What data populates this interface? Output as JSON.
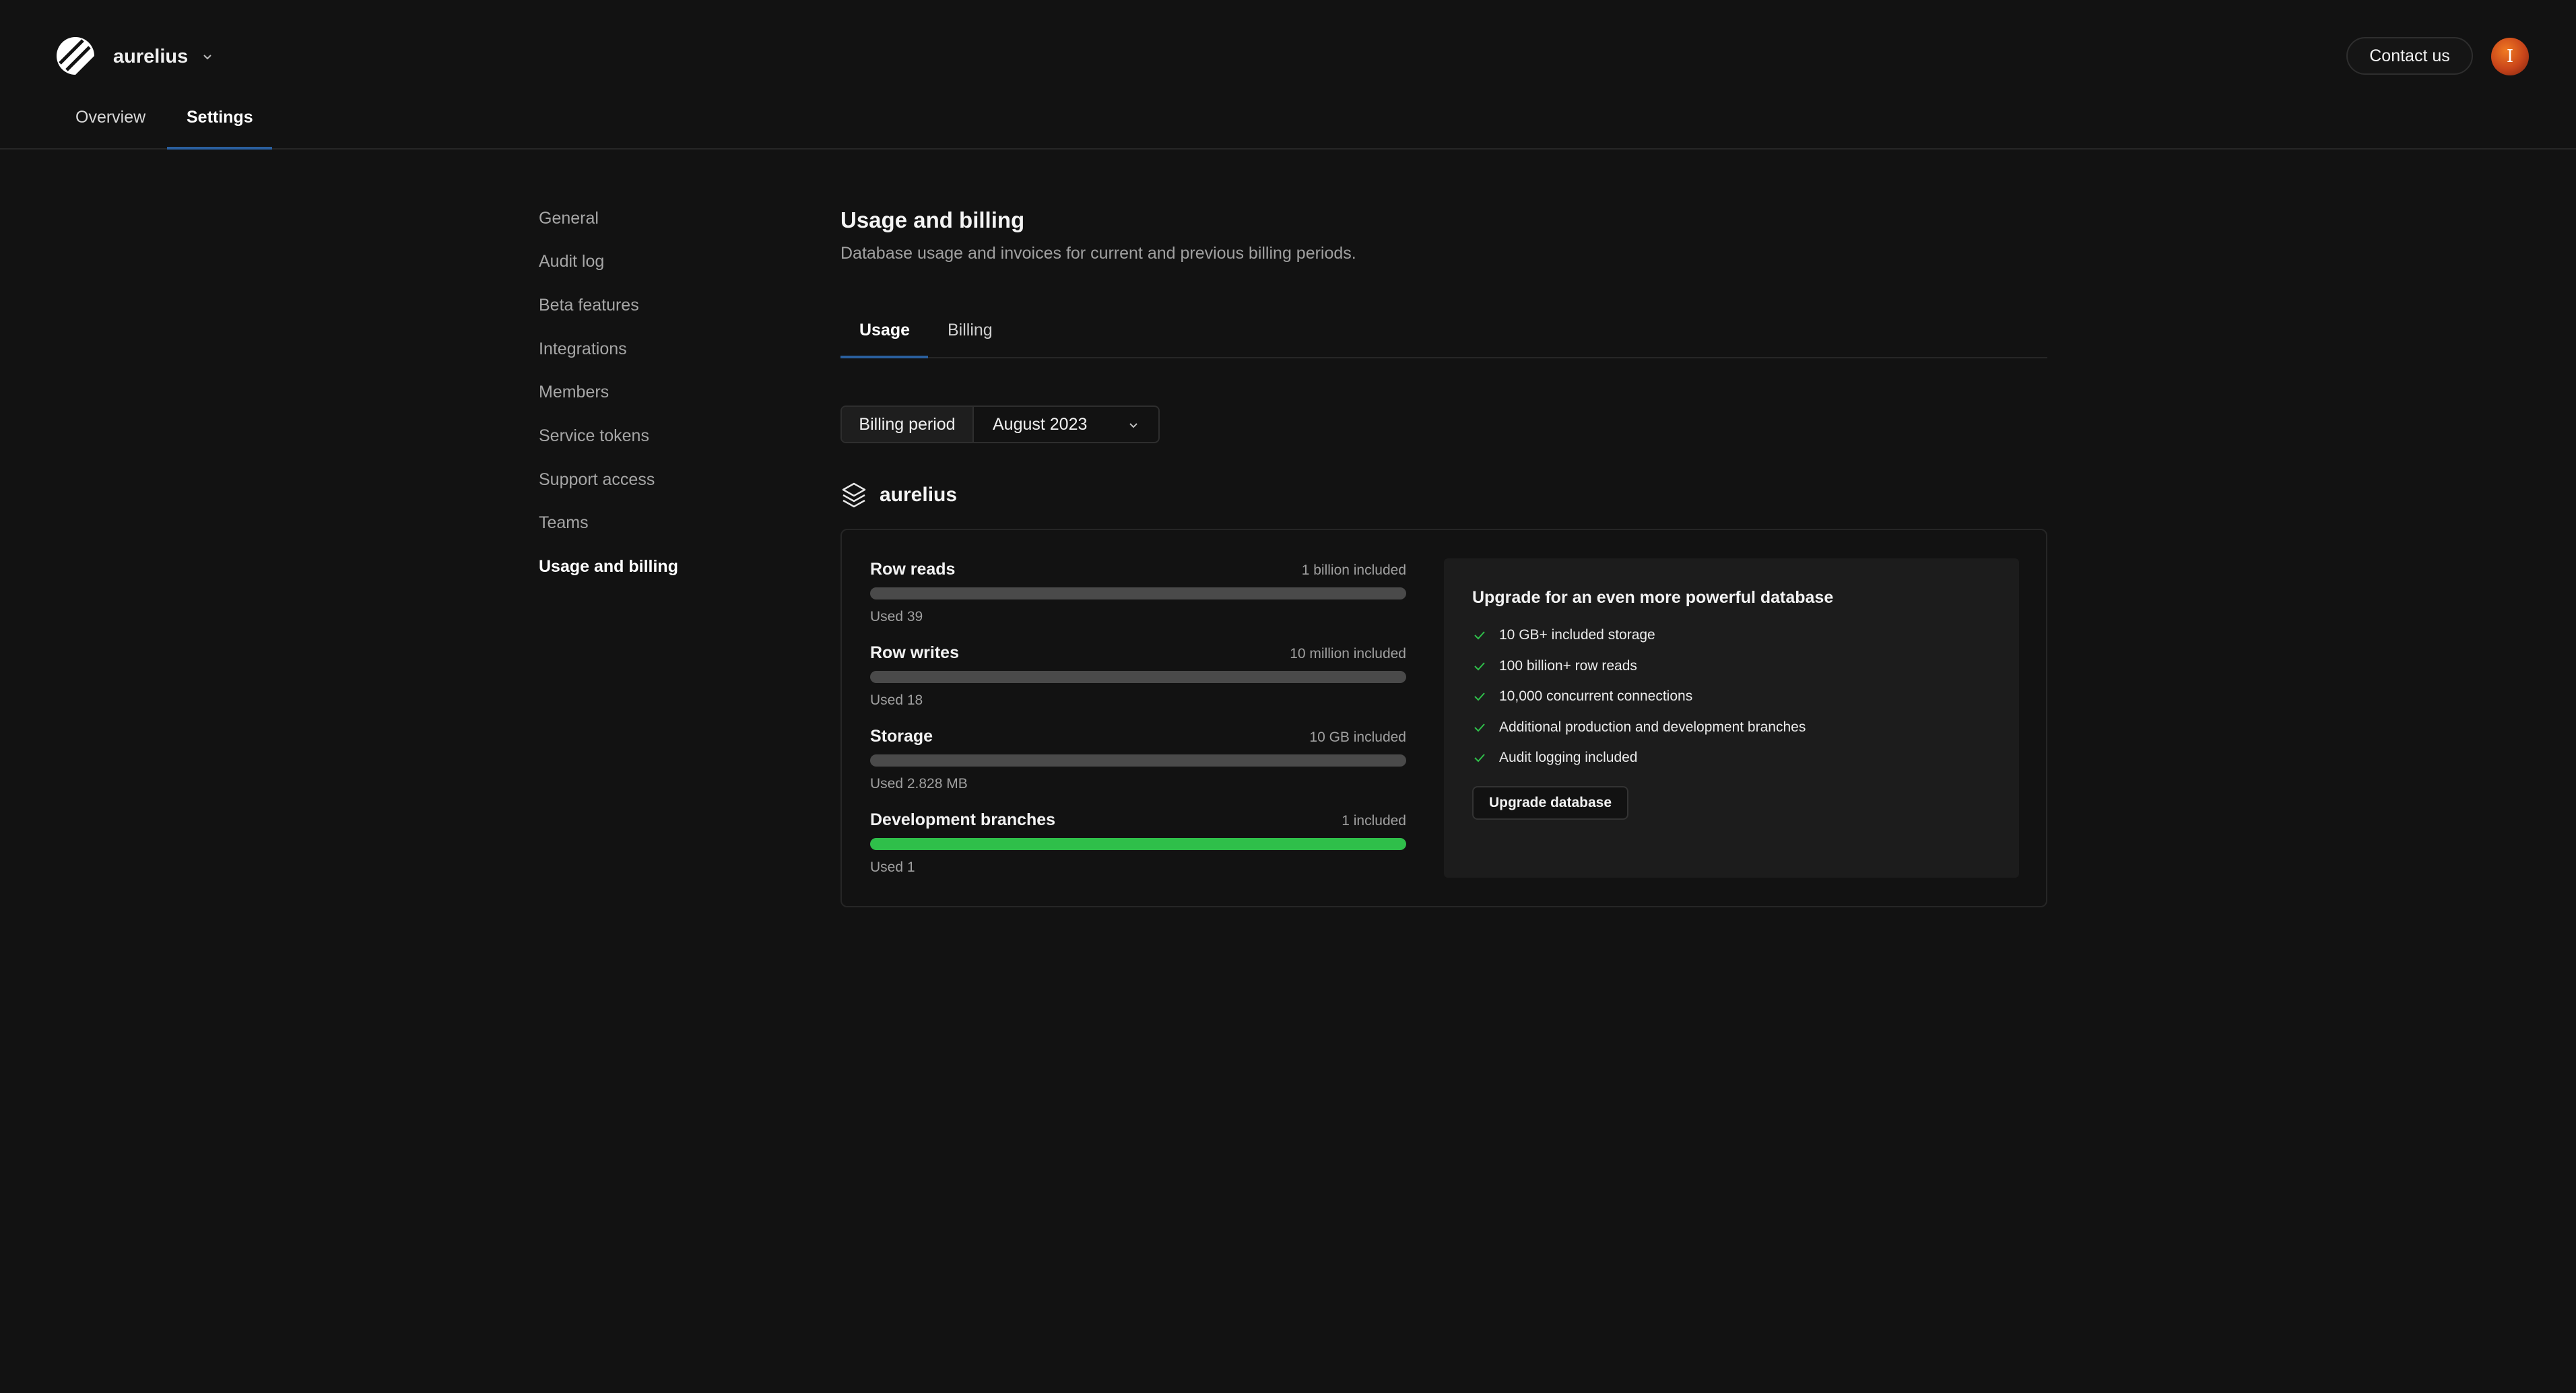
{
  "header": {
    "org_name": "aurelius",
    "nav": [
      {
        "label": "Overview"
      },
      {
        "label": "Settings"
      }
    ],
    "contact_label": "Contact us",
    "avatar_initial": "I"
  },
  "sidebar": {
    "items": [
      {
        "label": "General"
      },
      {
        "label": "Audit log"
      },
      {
        "label": "Beta features"
      },
      {
        "label": "Integrations"
      },
      {
        "label": "Members"
      },
      {
        "label": "Service tokens"
      },
      {
        "label": "Support access"
      },
      {
        "label": "Teams"
      },
      {
        "label": "Usage and billing"
      }
    ]
  },
  "main": {
    "title": "Usage and billing",
    "subtitle": "Database usage and invoices for current and previous billing periods.",
    "tabs": [
      {
        "label": "Usage"
      },
      {
        "label": "Billing"
      }
    ],
    "billing_period": {
      "label": "Billing period",
      "value": "August 2023"
    },
    "database_name": "aurelius",
    "metrics": [
      {
        "name": "Row reads",
        "included": "1 billion included",
        "used": "Used 39",
        "fill": 0
      },
      {
        "name": "Row writes",
        "included": "10 million included",
        "used": "Used 18",
        "fill": 0
      },
      {
        "name": "Storage",
        "included": "10 GB included",
        "used": "Used 2.828 MB",
        "fill": 0
      },
      {
        "name": "Development branches",
        "included": "1 included",
        "used": "Used 1",
        "fill": 1
      }
    ],
    "upgrade": {
      "title": "Upgrade for an even more powerful database",
      "features": [
        "10 GB+ included storage",
        "100 billion+ row reads",
        "10,000 concurrent connections",
        "Additional production and development branches",
        "Audit logging included"
      ],
      "button_label": "Upgrade database"
    }
  },
  "colors": {
    "background": "#121212",
    "accent_underline": "#2a5f9e",
    "success_green": "#2fbf4a",
    "bar_track": "#4a4a4a"
  }
}
